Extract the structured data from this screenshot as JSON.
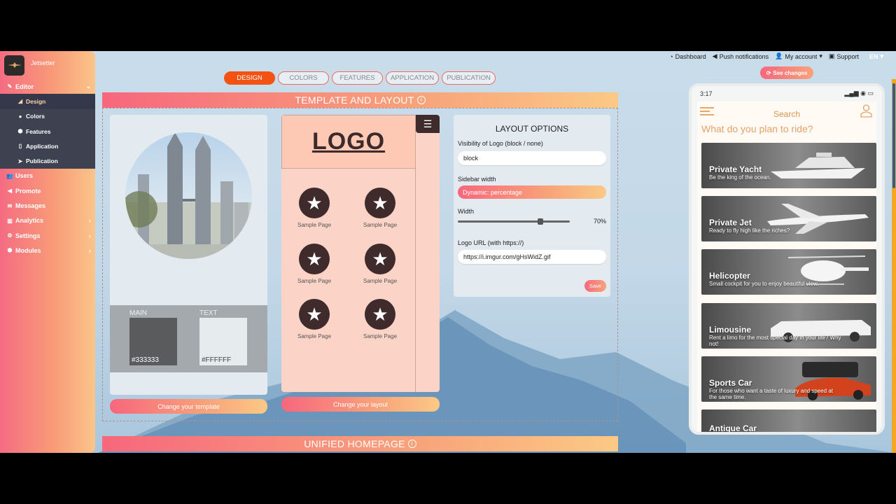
{
  "brand": {
    "name": "Jetsetter"
  },
  "sidebar": {
    "editor_label": "Editor",
    "sub_items": [
      {
        "label": "Design",
        "icon": "brush-icon"
      },
      {
        "label": "Colors",
        "icon": "palette-icon"
      },
      {
        "label": "Features",
        "icon": "cube-icon"
      },
      {
        "label": "Application",
        "icon": "mobile-icon"
      },
      {
        "label": "Publication",
        "icon": "send-icon"
      }
    ],
    "items": [
      {
        "label": "Users",
        "icon": "users-icon"
      },
      {
        "label": "Promote",
        "icon": "megaphone-icon"
      },
      {
        "label": "Messages",
        "icon": "envelope-icon"
      },
      {
        "label": "Analytics",
        "icon": "chart-icon"
      },
      {
        "label": "Settings",
        "icon": "gear-icon"
      },
      {
        "label": "Modules",
        "icon": "cubes-icon"
      }
    ]
  },
  "topnav": {
    "dashboard": "Dashboard",
    "push": "Push notifications",
    "account": "My account",
    "support": "Support",
    "lang": "EN"
  },
  "tabs": [
    "DESIGN",
    "COLORS",
    "FEATURES",
    "APPLICATION",
    "PUBLICATION"
  ],
  "template_section": {
    "title": "TEMPLATE AND LAYOUT",
    "main_label": "MAIN",
    "main_color": "#333333",
    "text_label": "TEXT",
    "text_color": "#FFFFFF",
    "change_template": "Change your template",
    "change_layout": "Change your layout",
    "logo_text": "LOGO",
    "sample_label": "Sample Page"
  },
  "layout_options": {
    "title": "LAYOUT OPTIONS",
    "visibility_label": "Visibility of Logo (block / none)",
    "visibility_value": "block",
    "sidebar_label": "Sidebar width",
    "sidebar_value": "Dynamic: percentage",
    "width_label": "Width",
    "width_value": "70%",
    "width_fraction": 0.75,
    "logo_url_label": "Logo URL (with https://)",
    "logo_url_value": "https://i.imgur.com/gHsWidZ.gif",
    "save": "Save"
  },
  "see_changes": "See changes",
  "unified_section": {
    "title": "UNIFIED HOMEPAGE"
  },
  "phone": {
    "time": "3:17",
    "title": "Search",
    "question": "What do you plan to ride?",
    "cards": [
      {
        "title": "Private Yacht",
        "subtitle": "Be the king of the ocean."
      },
      {
        "title": "Private Jet",
        "subtitle": "Ready to fly high like the riches?"
      },
      {
        "title": "Helicopter",
        "subtitle": "Small cockpit for you to enjoy beautiful view."
      },
      {
        "title": "Limousine",
        "subtitle": "Rent a limo for the most special day in your life? Why not!"
      },
      {
        "title": "Sports Car",
        "subtitle": "For those who want a taste of luxury and speed at the same time."
      },
      {
        "title": "Antique Car",
        "subtitle": ""
      }
    ]
  },
  "colors": {
    "accent": "#f45212",
    "brown": "#3f2b2b",
    "gold": "#e4a26a"
  }
}
